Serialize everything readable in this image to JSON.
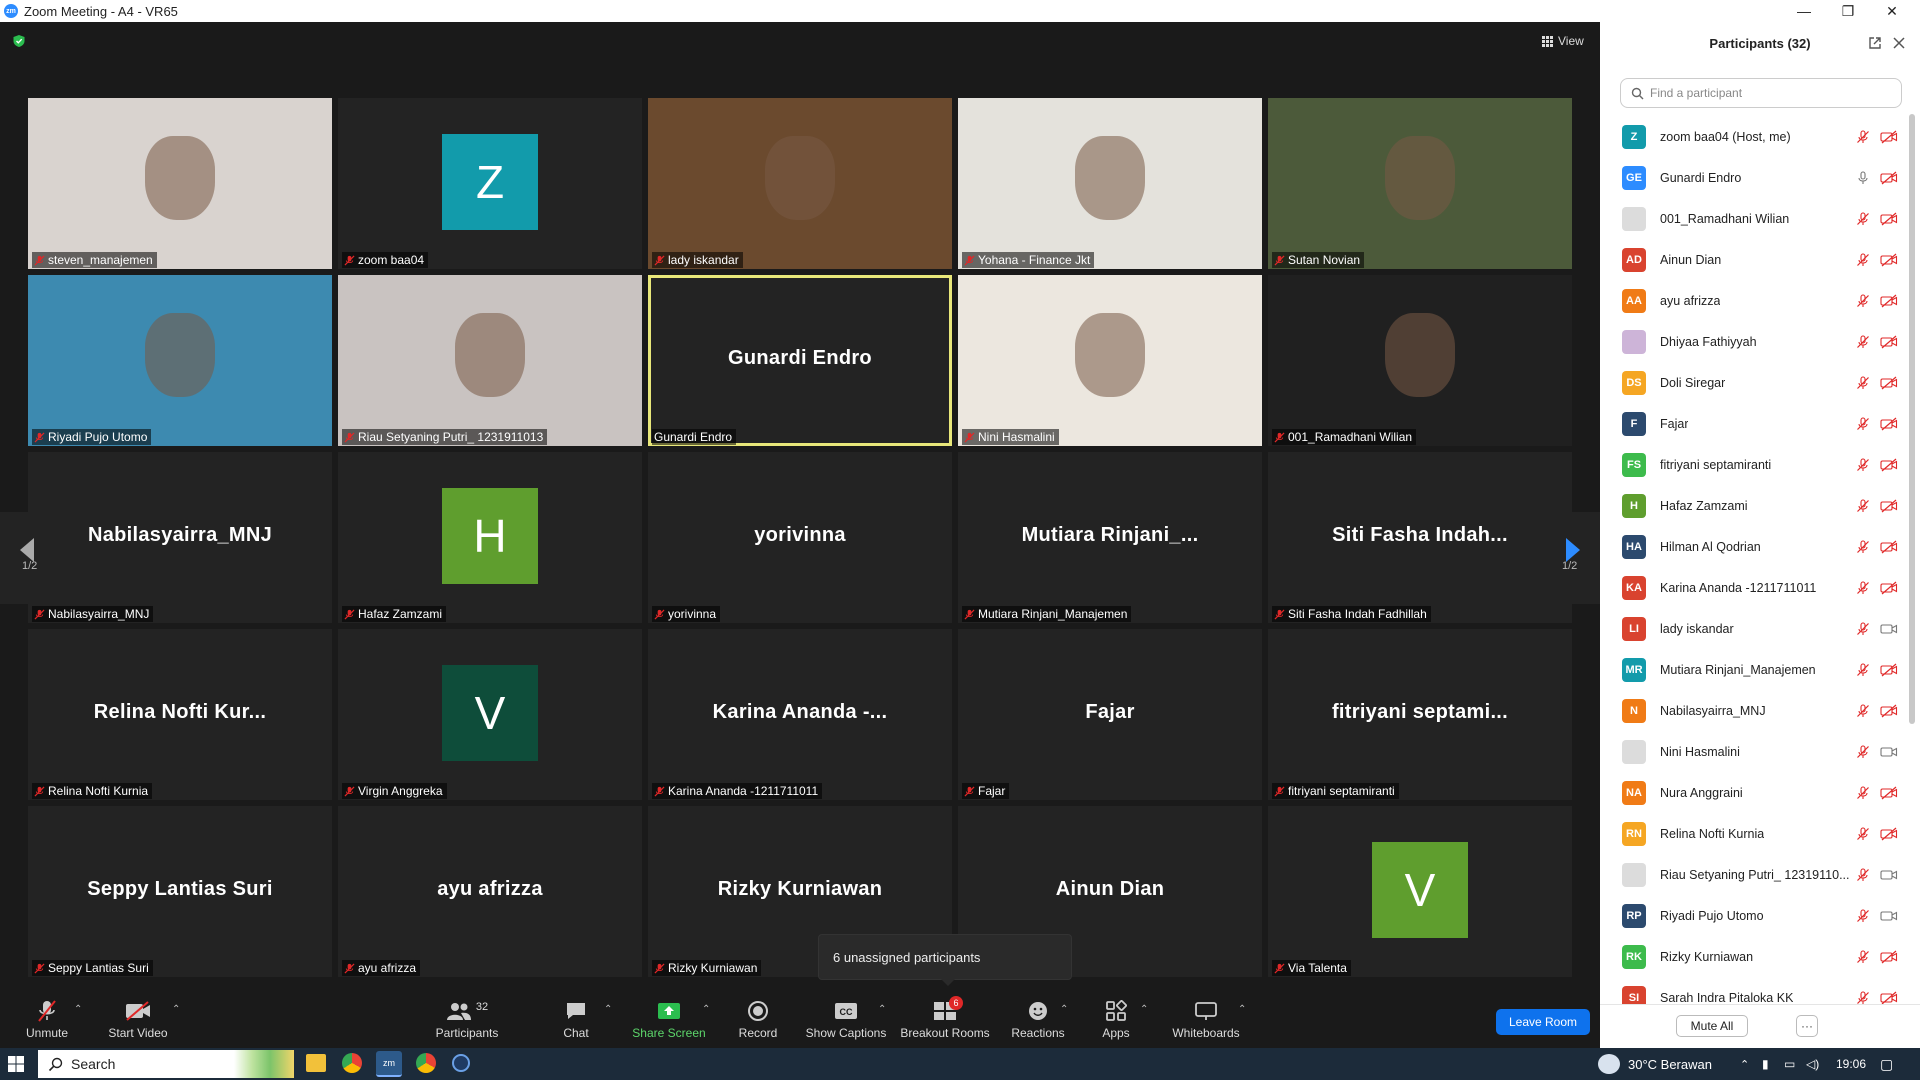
{
  "window": {
    "title": "Zoom Meeting - A4 - VR65",
    "logo_text": "zm"
  },
  "meeting": {
    "view_label": "View",
    "page_left": "1/2",
    "page_right": "1/2",
    "unassigned_tip": "6 unassigned participants",
    "tiles": [
      {
        "label": "steven_manajemen",
        "kind": "video",
        "bg": "#d9d3cf"
      },
      {
        "label": "zoom baa04",
        "kind": "avatar",
        "letter": "Z",
        "color": "#129bab"
      },
      {
        "label": "lady iskandar",
        "kind": "video",
        "bg": "#6b4a2e"
      },
      {
        "label": "Yohana - Finance Jkt",
        "kind": "video",
        "bg": "#e4e2dc"
      },
      {
        "label": "Sutan Novian",
        "kind": "video",
        "bg": "#4c5a3a"
      },
      {
        "label": "Riyadi Pujo Utomo",
        "kind": "video",
        "bg": "#3d8ab0"
      },
      {
        "label": "Riau Setyaning Putri_ 1231911013",
        "kind": "video",
        "bg": "#c9c3c1"
      },
      {
        "label": "Gunardi Endro",
        "kind": "name",
        "big": "Gunardi Endro",
        "active": true
      },
      {
        "label": "Nini Hasmalini",
        "kind": "video",
        "bg": "#ece7df"
      },
      {
        "label": "001_Ramadhani Wilian",
        "kind": "video",
        "bg": "#202020"
      },
      {
        "label": "Nabilasyairra_MNJ",
        "kind": "name",
        "big": "Nabilasyairra_MNJ"
      },
      {
        "label": "Hafaz Zamzami",
        "kind": "avatar",
        "letter": "H",
        "color": "#5f9e2e"
      },
      {
        "label": "yorivinna",
        "kind": "name",
        "big": "yorivinna"
      },
      {
        "label": "Mutiara Rinjani_Manajemen",
        "kind": "name",
        "big": "Mutiara  Rinjani_..."
      },
      {
        "label": "Siti Fasha Indah Fadhillah",
        "kind": "name",
        "big": "Siti  Fasha  Indah..."
      },
      {
        "label": "Relina Nofti Kurnia",
        "kind": "name",
        "big": "Relina  Nofti  Kur..."
      },
      {
        "label": "Virgin Anggreka",
        "kind": "avatar",
        "letter": "V",
        "color": "#0e4d3a"
      },
      {
        "label": "Karina Ananda -1211711011",
        "kind": "name",
        "big": "Karina  Ananda  -..."
      },
      {
        "label": "Fajar",
        "kind": "name",
        "big": "Fajar"
      },
      {
        "label": "fitriyani septamiranti",
        "kind": "name",
        "big": "fitriyani  septami..."
      },
      {
        "label": "Seppy Lantias Suri",
        "kind": "name",
        "big": "Seppy  Lantias  Suri"
      },
      {
        "label": "ayu afrizza",
        "kind": "name",
        "big": "ayu  afrizza"
      },
      {
        "label": "Rizky Kurniawan",
        "kind": "name",
        "big": "Rizky  Kurniawan"
      },
      {
        "label": "",
        "kind": "name",
        "big": "Ainun  Dian"
      },
      {
        "label": "Via Talenta",
        "kind": "avatar",
        "letter": "V",
        "color": "#5f9e2e"
      }
    ]
  },
  "toolbar": {
    "unmute": "Unmute",
    "start_video": "Start Video",
    "participants": "Participants",
    "participants_count": "32",
    "chat": "Chat",
    "share_screen": "Share Screen",
    "record": "Record",
    "captions": "Show Captions",
    "breakout": "Breakout Rooms",
    "breakout_badge": "6",
    "reactions": "Reactions",
    "apps": "Apps",
    "whiteboards": "Whiteboards",
    "leave": "Leave Room",
    "colors": {
      "leave": "#0e72ed",
      "share": "#5dd66b",
      "muted": "#e02828"
    }
  },
  "panel": {
    "title": "Participants (32)",
    "search_placeholder": "Find a participant",
    "mute_all": "Mute All",
    "more": "···",
    "participants": [
      {
        "name": "zoom baa04 (Host, me)",
        "initials": "Z",
        "color": "#129bab",
        "mic": "off",
        "cam": "off"
      },
      {
        "name": "Gunardi Endro",
        "initials": "GE",
        "color": "#2d8cff",
        "mic": "on",
        "cam": "off"
      },
      {
        "name": "001_Ramadhani Wilian",
        "initials": "",
        "color": "#dcdcdc",
        "mic": "off",
        "cam": "off",
        "photo": true
      },
      {
        "name": "Ainun Dian",
        "initials": "AD",
        "color": "#d9432f",
        "mic": "off",
        "cam": "off"
      },
      {
        "name": "ayu afrizza",
        "initials": "AA",
        "color": "#f07b16",
        "mic": "off",
        "cam": "off"
      },
      {
        "name": "Dhiyaa Fathiyyah",
        "initials": "",
        "color": "#cdb4d8",
        "mic": "off",
        "cam": "off",
        "photo": true
      },
      {
        "name": "Doli Siregar",
        "initials": "DS",
        "color": "#f5a623",
        "mic": "off",
        "cam": "off"
      },
      {
        "name": "Fajar",
        "initials": "F",
        "color": "#2c4a6e",
        "mic": "off",
        "cam": "off"
      },
      {
        "name": "fitriyani septamiranti",
        "initials": "FS",
        "color": "#3dbb4c",
        "mic": "off",
        "cam": "off"
      },
      {
        "name": "Hafaz Zamzami",
        "initials": "H",
        "color": "#5f9e2e",
        "mic": "off",
        "cam": "off"
      },
      {
        "name": "Hilman Al Qodrian",
        "initials": "HA",
        "color": "#2c4a6e",
        "mic": "off",
        "cam": "off"
      },
      {
        "name": "Karina Ananda -1211711011",
        "initials": "KA",
        "color": "#d9432f",
        "mic": "off",
        "cam": "off"
      },
      {
        "name": "lady iskandar",
        "initials": "LI",
        "color": "#d9432f",
        "mic": "off",
        "cam": "on"
      },
      {
        "name": "Mutiara Rinjani_Manajemen",
        "initials": "MR",
        "color": "#129bab",
        "mic": "off",
        "cam": "off"
      },
      {
        "name": "Nabilasyairra_MNJ",
        "initials": "N",
        "color": "#f07b16",
        "mic": "off",
        "cam": "off"
      },
      {
        "name": "Nini Hasmalini",
        "initials": "",
        "color": "#dcdcdc",
        "mic": "off",
        "cam": "on",
        "photo": true
      },
      {
        "name": "Nura Anggraini",
        "initials": "NA",
        "color": "#f07b16",
        "mic": "off",
        "cam": "off"
      },
      {
        "name": "Relina Nofti Kurnia",
        "initials": "RN",
        "color": "#f5a623",
        "mic": "off",
        "cam": "off"
      },
      {
        "name": "Riau Setyaning Putri_ 12319110...",
        "initials": "",
        "color": "#dcdcdc",
        "mic": "off",
        "cam": "on",
        "photo": true
      },
      {
        "name": "Riyadi Pujo Utomo",
        "initials": "RP",
        "color": "#2c4a6e",
        "mic": "off",
        "cam": "on"
      },
      {
        "name": "Rizky Kurniawan",
        "initials": "RK",
        "color": "#3dbb4c",
        "mic": "off",
        "cam": "off"
      },
      {
        "name": "Sarah Indra Pitaloka KK",
        "initials": "SI",
        "color": "#d9432f",
        "mic": "off",
        "cam": "off"
      }
    ]
  },
  "taskbar": {
    "search": "Search",
    "weather": "30°C  Berawan",
    "time": "19:06"
  }
}
